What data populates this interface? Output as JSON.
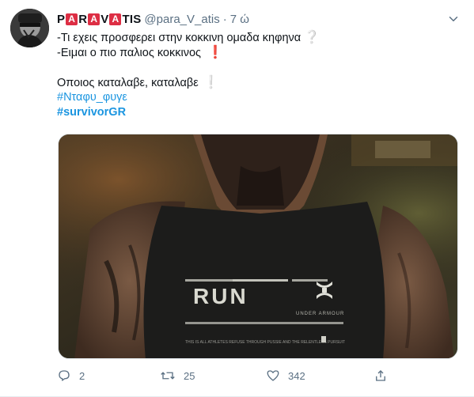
{
  "author": {
    "name_parts": [
      "P",
      "A",
      "R",
      "A",
      "V",
      "A",
      "TIS"
    ],
    "handle": "@para_V_atis",
    "separator": "·",
    "time": "7 ώ"
  },
  "tweet": {
    "line1": "-Τι εχεις προσφερει στην κοκκινη ομαδα κηφηνα",
    "line1_icon": "❔",
    "line2": "-Ειμαι ο πιο παλιος κοκκινος",
    "line2_icon": "❗",
    "line3": "Οποιος καταλαβε, καταλαβε",
    "line3_icon": "❕",
    "hashtag1": "#Νταφυ_φυγε",
    "hashtag2": "#survivorGR"
  },
  "media": {
    "shirt_text": "RUN",
    "brand_text": "UNDER ARMOUR",
    "fine_print": "THIS IS ALL ATHLETES REFUSE THROUGH PUSSIE AND THE RELENTLESS PURSUIT"
  },
  "actions": {
    "replies": "2",
    "retweets": "25",
    "likes": "342"
  },
  "colors": {
    "accent": "#1b95e0",
    "muted": "#5b7083",
    "chip_red": "#dd2e44"
  }
}
